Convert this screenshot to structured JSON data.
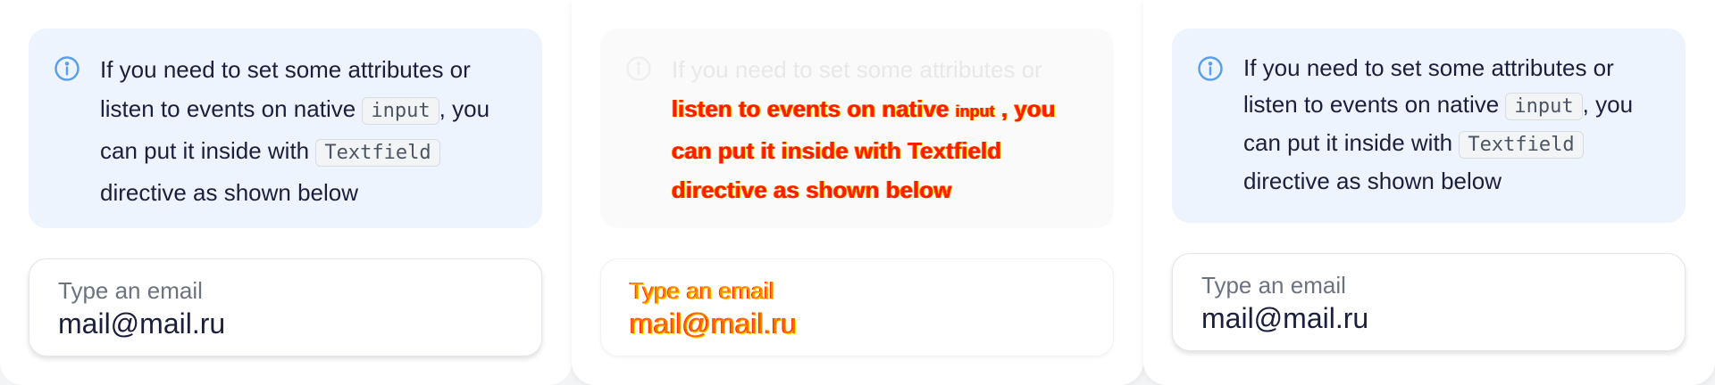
{
  "notice": {
    "part1": "If you need to set some attributes or listen to events on native",
    "code1": "input",
    "part2": ", you can put it inside with",
    "code2": "Textfield",
    "part3": "directive as shown below"
  },
  "notice_faded_line1": "If you need to set some attributes or",
  "notice_glitch": {
    "line2a": "listen to events on native",
    "line2b": "input",
    "line2c": ", you",
    "line3": "can put it inside with Textfield",
    "line4": "directive as shown below"
  },
  "field": {
    "label": "Type an email",
    "value": "mail@mail.ru"
  },
  "icons": {
    "info": "info-circle-icon"
  },
  "colors": {
    "notice_bg": "#edf4fd",
    "icon_accent": "#5aa0e8",
    "glitch_red": "#ff1a00",
    "glitch_yellow": "#ff8a00"
  }
}
